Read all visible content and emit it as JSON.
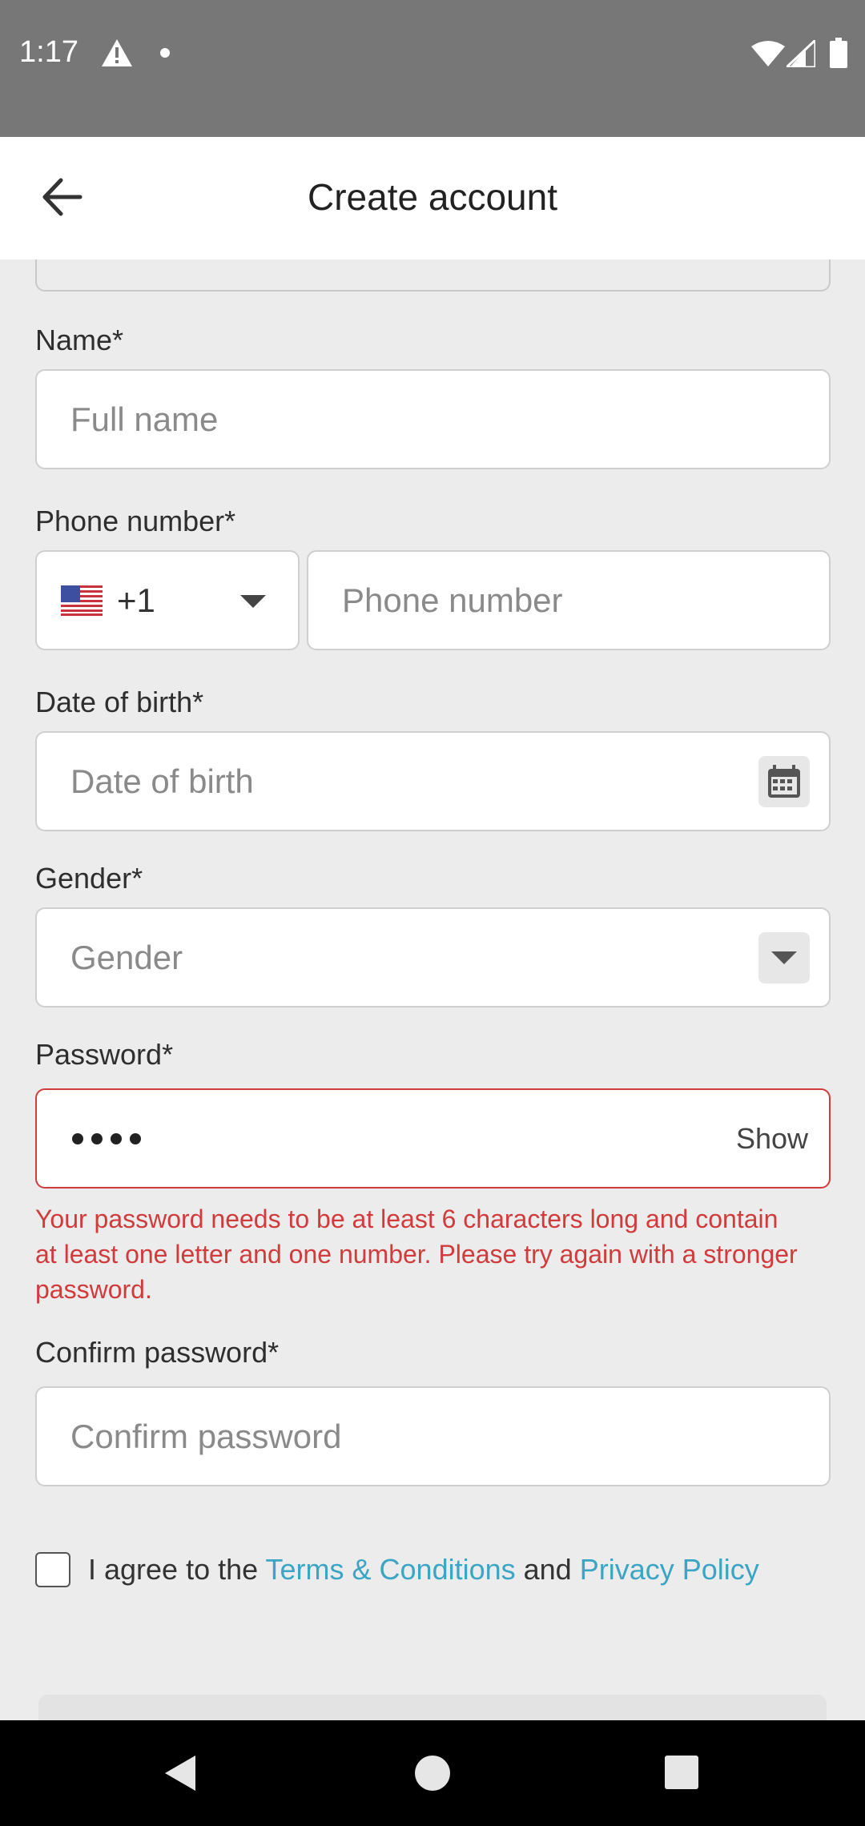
{
  "status_bar": {
    "time": "1:17",
    "icons": [
      "warning-icon",
      "notification-dot-icon",
      "wifi-icon",
      "signal-icon",
      "battery-icon"
    ]
  },
  "app_bar": {
    "title": "Create account",
    "back_icon": "arrow-left-icon"
  },
  "form": {
    "name": {
      "label": "Name*",
      "placeholder": "Full name",
      "value": ""
    },
    "phone": {
      "label": "Phone number*",
      "country_flag": "us-flag-icon",
      "country_code": "+1",
      "placeholder": "Phone number",
      "value": ""
    },
    "dob": {
      "label": "Date of birth*",
      "placeholder": "Date of birth",
      "icon": "calendar-icon"
    },
    "gender": {
      "label": "Gender*",
      "placeholder": "Gender",
      "icon": "dropdown-arrow-icon"
    },
    "password": {
      "label": "Password*",
      "masked_length": 4,
      "show_label": "Show",
      "error": "Your password needs to be at least 6 characters long and contain at least one letter and one number. Please try again with a stronger password."
    },
    "confirm_password": {
      "label": "Confirm password*",
      "placeholder": "Confirm password"
    },
    "agreement": {
      "prefix": "I agree to the ",
      "terms_link": "Terms & Conditions",
      "middle": " and ",
      "privacy_link": "Privacy Policy",
      "checked": false
    }
  },
  "colors": {
    "error": "#d13b3b",
    "link": "#3aa5c4",
    "background": "#ececec"
  },
  "nav_bar": {
    "icons": [
      "nav-back-icon",
      "nav-home-icon",
      "nav-recents-icon"
    ]
  }
}
